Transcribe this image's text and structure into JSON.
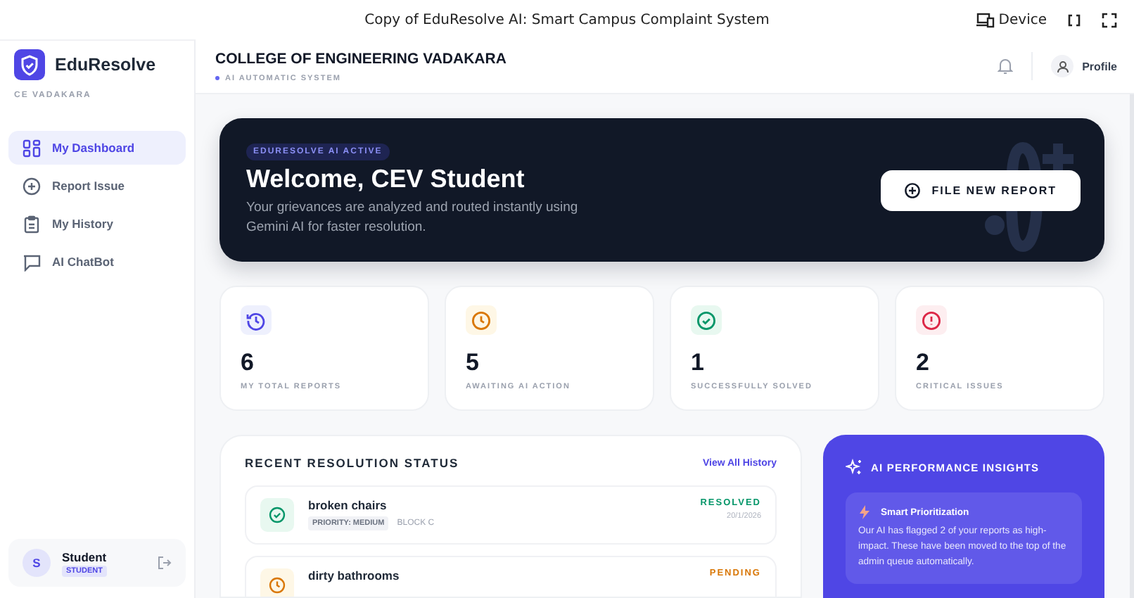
{
  "topbar": {
    "title": "Copy of EduResolve AI: Smart Campus Complaint System",
    "device_label": "Device"
  },
  "sidebar": {
    "brand": "EduResolve",
    "subtitle": "CE VADAKARA",
    "items": [
      {
        "label": "My Dashboard",
        "selected": true
      },
      {
        "label": "Report Issue",
        "selected": false
      },
      {
        "label": "My History",
        "selected": false
      },
      {
        "label": "AI ChatBot",
        "selected": false
      }
    ],
    "user": {
      "initial": "S",
      "name": "Student",
      "role": "STUDENT"
    }
  },
  "header": {
    "title": "COLLEGE OF ENGINEERING VADAKARA",
    "subtitle": "AI AUTOMATIC SYSTEM",
    "profile_label": "Profile"
  },
  "hero": {
    "badge": "EDURESOLVE AI ACTIVE",
    "title": "Welcome, CEV Student",
    "text": "Your grievances are analyzed and routed instantly using Gemini AI for faster resolution.",
    "button": "FILE NEW REPORT"
  },
  "stats": [
    {
      "kind": "history",
      "value": "6",
      "label": "MY TOTAL REPORTS"
    },
    {
      "kind": "clock",
      "value": "5",
      "label": "AWAITING AI ACTION"
    },
    {
      "kind": "check",
      "value": "1",
      "label": "SUCCESSFULLY SOLVED"
    },
    {
      "kind": "alert",
      "value": "2",
      "label": "CRITICAL ISSUES"
    }
  ],
  "recent": {
    "title": "RECENT RESOLUTION STATUS",
    "link": "View All History",
    "items": [
      {
        "kind": "resolved",
        "title": "broken chairs",
        "priority": "PRIORITY: MEDIUM",
        "location": "BLOCK C",
        "status": "RESOLVED",
        "date": "20/1/2026"
      },
      {
        "kind": "pending",
        "title": "dirty bathrooms",
        "status": "PENDING"
      }
    ]
  },
  "insights": {
    "title": "AI PERFORMANCE INSIGHTS",
    "card_title": "Smart Prioritization",
    "card_text": "Our AI has flagged 2 of your reports as high-impact. These have been moved to the top of the admin queue automatically."
  }
}
